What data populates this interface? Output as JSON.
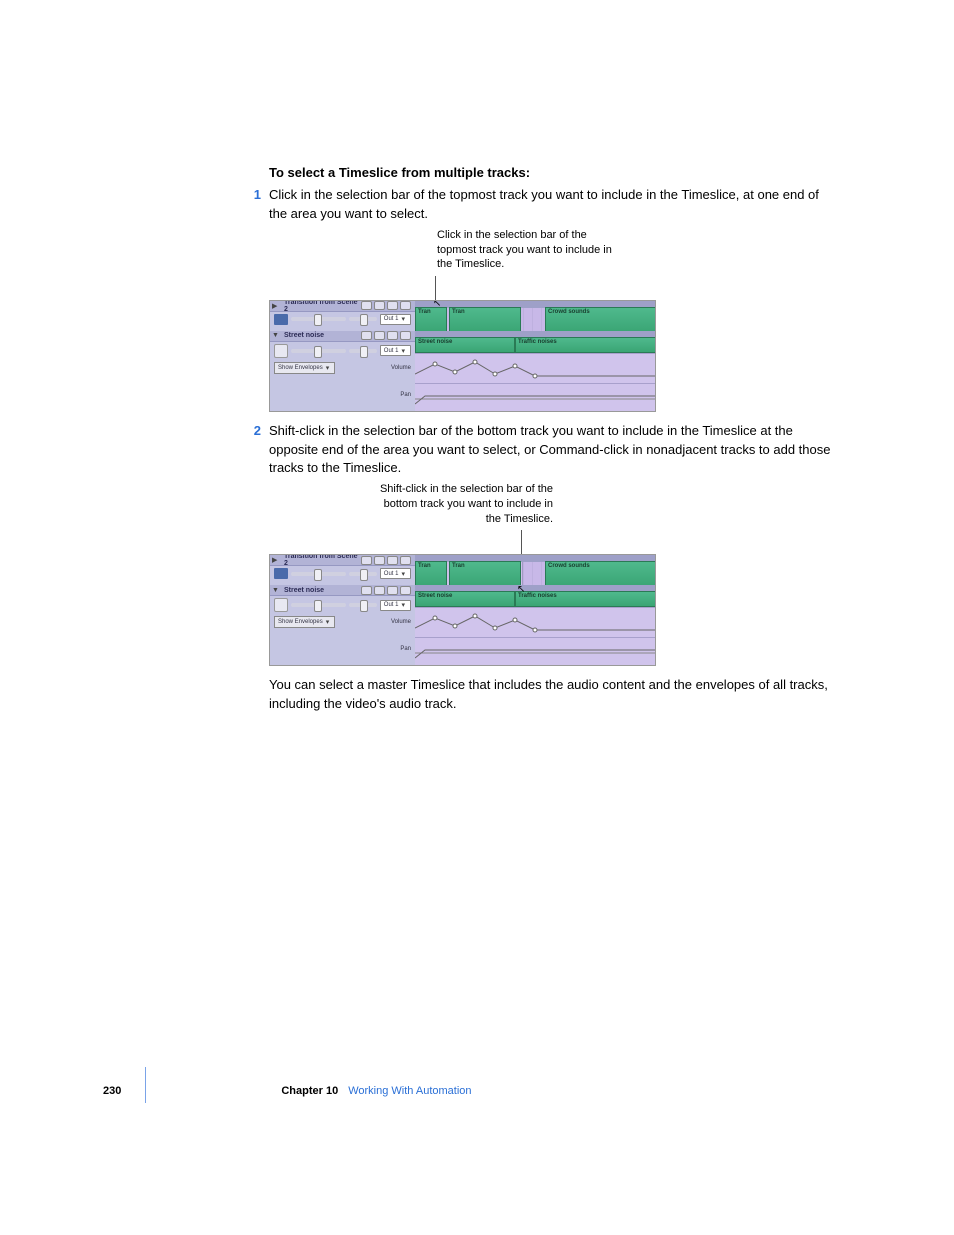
{
  "heading": "To select a Timeslice from multiple tracks:",
  "step1": {
    "num": "1",
    "text": "Click in the selection bar of the topmost track you want to include in the Timeslice, at one end of the area you want to select."
  },
  "callout1": "Click in the selection bar of the topmost track you want to include in the Timeslice.",
  "step2": {
    "num": "2",
    "text": "Shift-click in the selection bar of the bottom track you want to include in the Timeslice at the opposite end of the area you want to select, or Command-click in nonadjacent tracks to add those tracks to the Timeslice."
  },
  "callout2": "Shift-click in the selection bar of the bottom track you want to include in the Timeslice.",
  "conclusion": "You can select a master Timeslice that includes the audio content and the envelopes of all tracks, including the video's audio track.",
  "figure": {
    "track1_name": "Transition from Scene 2",
    "track2_name": "Street noise",
    "out_label": "Out 1",
    "env_button": "Show Envelopes",
    "volume_label": "Volume",
    "pan_label": "Pan",
    "clip_tran": "Tran",
    "clip_crowd": "Crowd sounds",
    "clip_street": "Street noise",
    "clip_traffic": "Traffic noises"
  },
  "footer": {
    "page": "230",
    "chapter": "Chapter 10",
    "title": "Working With Automation"
  }
}
